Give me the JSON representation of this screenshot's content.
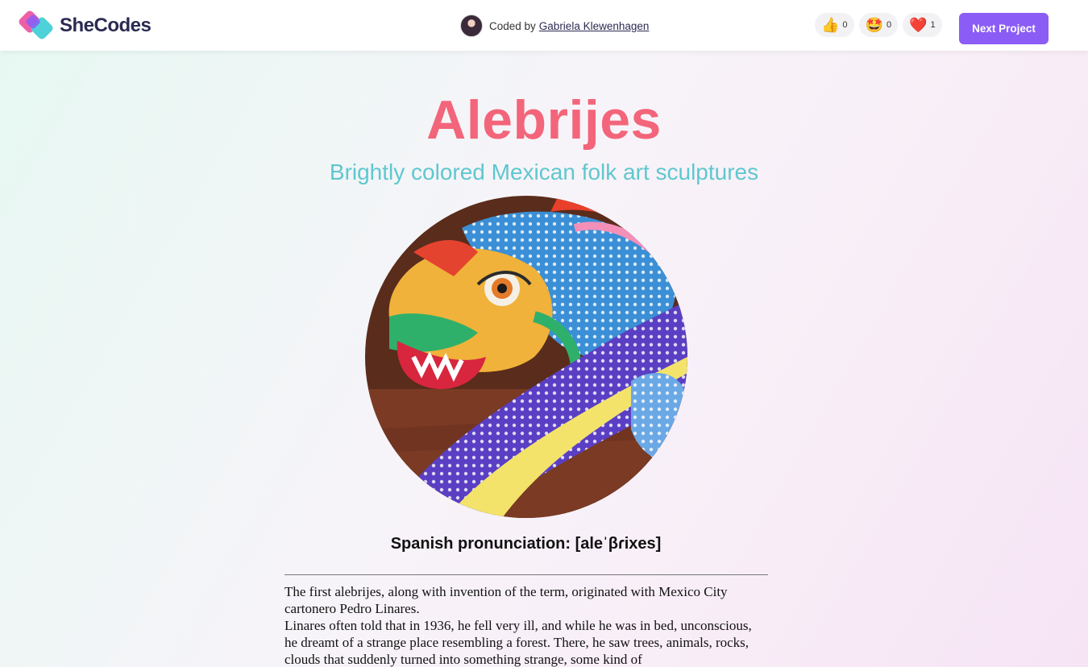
{
  "header": {
    "brand": "SheCodes",
    "coded_by_label": "Coded by",
    "author": "Gabriela Klewenhagen",
    "reactions": [
      {
        "icon": "thumbs-up-icon",
        "glyph": "👍",
        "count": "0"
      },
      {
        "icon": "star-struck-icon",
        "glyph": "🤩",
        "count": "0"
      },
      {
        "icon": "heart-icon",
        "glyph": "❤️",
        "count": "1"
      }
    ],
    "next_button": "Next Project"
  },
  "main": {
    "title": "Alebrijes",
    "subtitle": "Brightly colored Mexican folk art sculptures",
    "pronunciation": "Spanish pronunciation: [aleˈβɾixes]",
    "paragraphs": [
      "The first alebrijes, along with invention of the term, originated with Mexico City cartonero Pedro Linares.",
      "Linares often told that in 1936, he fell very ill, and while he was in bed, unconscious, he dreamt of a strange place resembling a forest. There, he saw trees, animals, rocks, clouds that suddenly turned into something strange, some kind of"
    ]
  },
  "colors": {
    "title": "#f3657a",
    "subtitle": "#5fc7cf",
    "button": "#8b5cf6",
    "brand_text": "#2b2a52"
  }
}
